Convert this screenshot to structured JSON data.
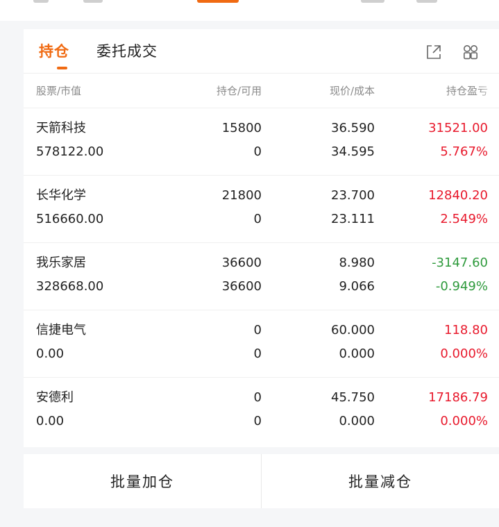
{
  "colors": {
    "accent": "#f06a12",
    "up": "#e8192c",
    "down": "#2e9a3c"
  },
  "tabs": [
    {
      "label": "持仓"
    },
    {
      "label": "委托成交"
    }
  ],
  "toolbar_icons": [
    "share-icon",
    "grid-icon"
  ],
  "table": {
    "headers": [
      "股票/市值",
      "持仓/可用",
      "现价/成本",
      "持仓盈亏"
    ],
    "rows": [
      {
        "name": "天箭科技",
        "market_value": "578122.00",
        "position": "15800",
        "available": "0",
        "price": "36.590",
        "cost": "34.595",
        "pnl": "31521.00",
        "pnl_pct": "5.767%",
        "trend": "up"
      },
      {
        "name": "长华化学",
        "market_value": "516660.00",
        "position": "21800",
        "available": "0",
        "price": "23.700",
        "cost": "23.111",
        "pnl": "12840.20",
        "pnl_pct": "2.549%",
        "trend": "up"
      },
      {
        "name": "我乐家居",
        "market_value": "328668.00",
        "position": "36600",
        "available": "36600",
        "price": "8.980",
        "cost": "9.066",
        "pnl": "-3147.60",
        "pnl_pct": "-0.949%",
        "trend": "down"
      },
      {
        "name": "信捷电气",
        "market_value": "0.00",
        "position": "0",
        "available": "0",
        "price": "60.000",
        "cost": "0.000",
        "pnl": "118.80",
        "pnl_pct": "0.000%",
        "trend": "up"
      },
      {
        "name": "安德利",
        "market_value": "0.00",
        "position": "0",
        "available": "0",
        "price": "45.750",
        "cost": "0.000",
        "pnl": "17186.79",
        "pnl_pct": "0.000%",
        "trend": "up"
      }
    ]
  },
  "actions": {
    "batch_add": "批量加仓",
    "batch_reduce": "批量减仓"
  }
}
